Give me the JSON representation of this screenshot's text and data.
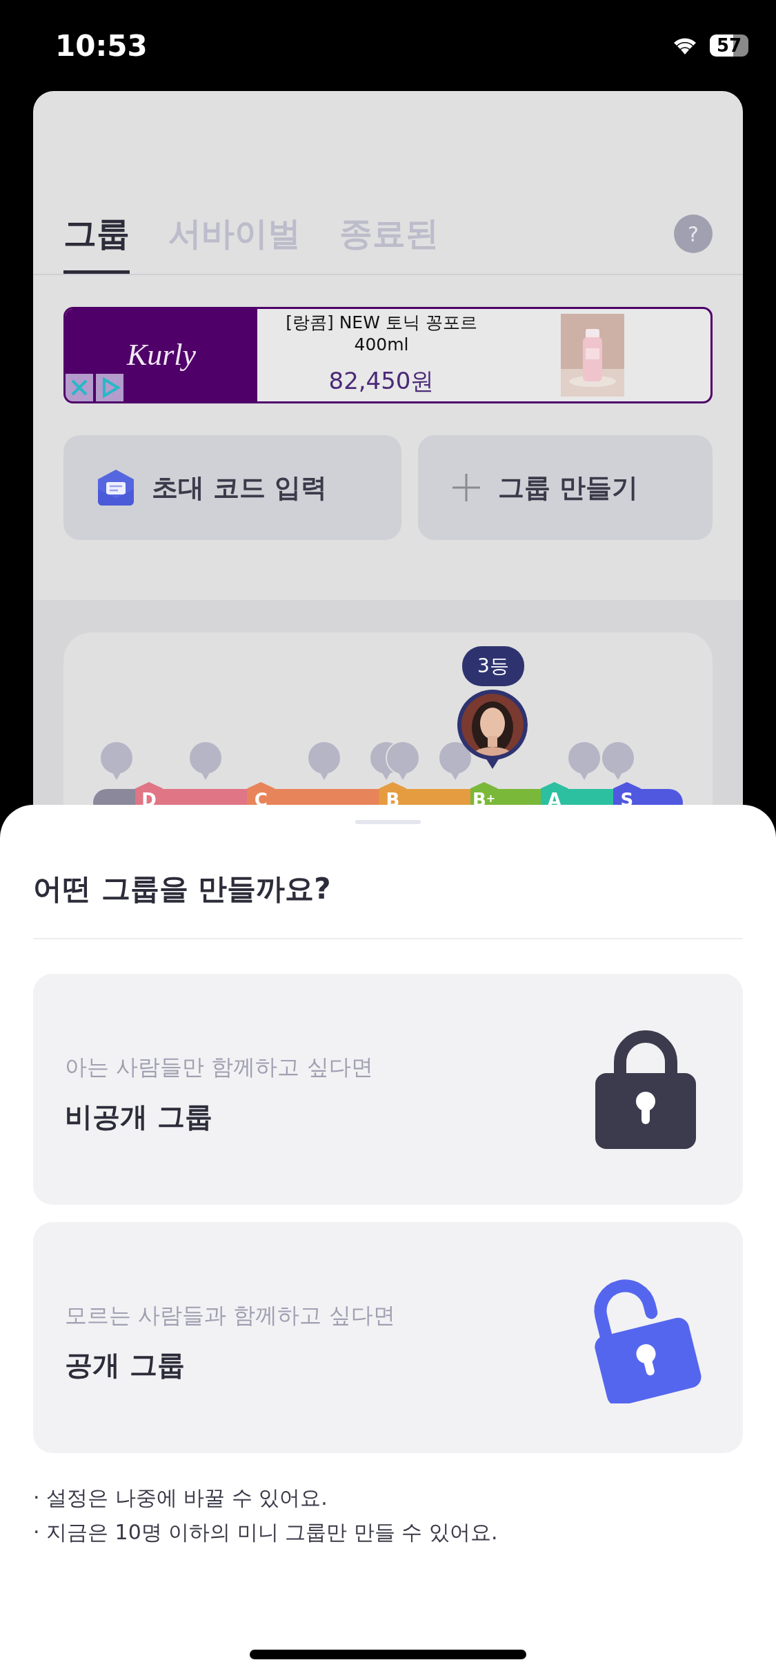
{
  "status_bar": {
    "time": "10:53",
    "battery": "57"
  },
  "tabs": [
    {
      "label": "그룹",
      "selected": true
    },
    {
      "label": "서바이벌",
      "selected": false
    },
    {
      "label": "종료된",
      "selected": false
    }
  ],
  "help": {
    "label": "?"
  },
  "ad": {
    "brand": "Kurly",
    "title": "[랑콤] NEW 토닉 꽁포르",
    "subtitle": "400ml",
    "price": "82,450원"
  },
  "actions": [
    {
      "kind": "invite",
      "label": "초대 코드 입력"
    },
    {
      "kind": "create",
      "label": "그룹 만들기"
    }
  ],
  "ranking": {
    "rank": "3등",
    "tiers": [
      {
        "color": "#8a889a"
      },
      {
        "label": "D",
        "color": "#e07585"
      },
      {
        "label": "C",
        "color": "#e8845a"
      },
      {
        "label": "B",
        "color": "#e59c40"
      },
      {
        "label": "B$^{+}$",
        "color": "#7ab83a"
      },
      {
        "label": "A",
        "color": "#2cc0a0"
      },
      {
        "label": "S",
        "color": "#5058e0"
      }
    ]
  },
  "sheet": {
    "title": "어떤 그룹을 만들까요?",
    "options": [
      {
        "kind": "private",
        "hint": "아는 사람들만 함께하고 싶다면",
        "label": "비공개 그룹"
      },
      {
        "kind": "public",
        "hint": "모르는 사람들과 함께하고 싶다면",
        "label": "공개 그룹"
      }
    ],
    "notes": [
      "· 설정은 나중에 바꿀 수 있어요.",
      "· 지금은 10명 이하의 미니 그룹만 만들 수 있어요."
    ]
  }
}
